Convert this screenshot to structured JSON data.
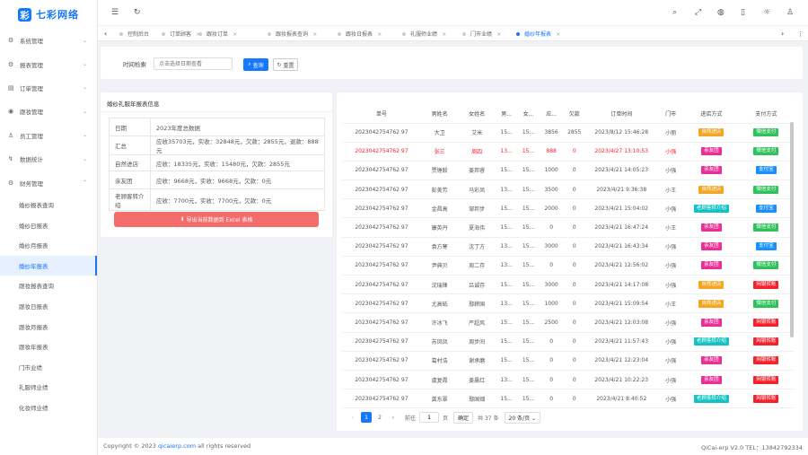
{
  "app": {
    "logo_mark": "彩",
    "title": "七彩网络"
  },
  "sidebar": {
    "menus": [
      {
        "label": "系统管理",
        "icon": "⚙"
      },
      {
        "label": "报表管理",
        "icon": "⚙"
      },
      {
        "label": "订单管理",
        "icon": "▤"
      },
      {
        "label": "跟妆管理",
        "icon": "◉"
      },
      {
        "label": "员工管理",
        "icon": "♙"
      },
      {
        "label": "数据统计",
        "icon": "↯"
      },
      {
        "label": "财务管理",
        "icon": "⚙"
      }
    ],
    "subitems": [
      "婚纱报表查询",
      "婚纱日报表",
      "婚纱月报表",
      "婚纱年报表",
      "跟妆报表查询",
      "跟妆日报表",
      "跟妆月报表",
      "跟妆年报表",
      "门市业绩",
      "礼服师业绩",
      "化妆师业绩"
    ],
    "active_index": 3
  },
  "header": {
    "icons": [
      "menu-fold-icon",
      "refresh-icon"
    ],
    "right_icons": [
      "search-icon",
      "expand-icon",
      "globe-icon",
      "mobile-icon",
      "theme-icon",
      "user-icon"
    ]
  },
  "tabs": [
    {
      "label": "控制后台",
      "closable": false
    },
    {
      "label": "订单顾客",
      "closable": true
    },
    {
      "label": "跟妆订单",
      "closable": true
    },
    {
      "label": "跟妆报表查询",
      "closable": true
    },
    {
      "label": "跟妆日报表",
      "closable": true
    },
    {
      "label": "礼服师业绩",
      "closable": true
    },
    {
      "label": "门市业绩",
      "closable": true
    },
    {
      "label": "婚纱年报表",
      "closable": true,
      "active": true
    }
  ],
  "search": {
    "label": "时间检索",
    "placeholder": "点击选择日期查看",
    "query_btn": "查询",
    "reset_btn": "重置"
  },
  "info": {
    "title": "婚纱礼服年报表信息",
    "rows": [
      {
        "k": "日期",
        "v": "2023年度总数据"
      },
      {
        "k": "汇总",
        "v": "应收35703元，实收：32848元，欠款：2855元，退款：888元"
      },
      {
        "k": "自然进店",
        "v": "应收：18335元，实收：15480元，欠款：2855元"
      },
      {
        "k": "亲友团",
        "v": "应收：9668元，实收：9668元，欠款：0元"
      },
      {
        "k": "老顾客转介绍",
        "v": "应收：7700元，实收：7700元，欠款：0元"
      }
    ],
    "export_btn": "导出当前数据到 Excel 表格"
  },
  "table": {
    "columns": [
      "单号",
      "男姓名",
      "女姓名",
      "男...",
      "女...",
      "应...",
      "欠款",
      "订单时间",
      "门市",
      "进店方式",
      "支付方式"
    ],
    "rows": [
      [
        "2023042754762 97",
        "大卫",
        "艾米",
        "15...",
        "15...",
        "3856",
        "2855",
        "2023/8/12 15:46:28",
        "小丽",
        "自然进店",
        "微信支付"
      ],
      [
        "2023042754762 97",
        "张三",
        "周四",
        "13...",
        "15...",
        "888",
        "0",
        "2023/4/27 13:10:53",
        "小强",
        "亲友团",
        "微信支付"
      ],
      [
        "2023042754762 97",
        "贾锤毅",
        "姜邦睿",
        "15...",
        "15...",
        "1000",
        "0",
        "2023/4/21 14:05:23",
        "小强",
        "亲友团",
        "支付宝"
      ],
      [
        "2023042754762 97",
        "彭美芳",
        "马彩凤",
        "13...",
        "15...",
        "3500",
        "0",
        "2023/4/21 9:36:38",
        "小王",
        "自然进店",
        "微信支付"
      ],
      [
        "2023042754762 97",
        "金昌高",
        "邹邦步",
        "15...",
        "15...",
        "2000",
        "0",
        "2023/4/21 15:04:02",
        "小强",
        "老顾客转介绍",
        "支付宝"
      ],
      [
        "2023042754762 97",
        "康英丹",
        "夏海伟",
        "15...",
        "15...",
        "0",
        "0",
        "2023/4/21 16:47:24",
        "小王",
        "亲友团",
        "微信支付"
      ],
      [
        "2023042754762 97",
        "袁方寒",
        "沈丁方",
        "13...",
        "15...",
        "3000",
        "0",
        "2023/4/21 16:43:34",
        "小强",
        "亲友团",
        "支付宝"
      ],
      [
        "2023042754762 97",
        "尹典贝",
        "周二存",
        "13...",
        "15...",
        "0",
        "0",
        "2023/4/21 12:56:02",
        "小强",
        "亲友团",
        "微信支付"
      ],
      [
        "2023042754762 97",
        "沈瑞锋",
        "吕诚存",
        "15...",
        "15...",
        "3000",
        "0",
        "2023/4/21 14:17:08",
        "小强",
        "自然进店",
        "网银转账"
      ],
      [
        "2023042754762 97",
        "尤高砥",
        "鄢耕国",
        "13...",
        "15...",
        "1000",
        "0",
        "2023/4/21 15:09:54",
        "小王",
        "自然进店",
        "微信支付"
      ],
      [
        "2023042754762 97",
        "许冰飞",
        "严超风",
        "15...",
        "15...",
        "2500",
        "0",
        "2023/4/21 12:03:08",
        "小强",
        "亲友团",
        "网银转账"
      ],
      [
        "2023042754762 97",
        "苏凤凤",
        "周步间",
        "15...",
        "15...",
        "0",
        "0",
        "2023/4/21 11:57:43",
        "小强",
        "老顾客转介绍",
        "网银转账"
      ],
      [
        "2023042754762 97",
        "葛村浩",
        "谢承磨",
        "15...",
        "15...",
        "0",
        "0",
        "2023/4/21 12:23:04",
        "小强",
        "亲友团",
        "网银转账"
      ],
      [
        "2023042754762 97",
        "虞复霞",
        "姜晨红",
        "13...",
        "15...",
        "0",
        "0",
        "2023/4/21 10:22:23",
        "小强",
        "亲友团",
        "网银转账"
      ],
      [
        "2023042754762 97",
        "龚东翠",
        "鄢国钿",
        "15...",
        "15...",
        "0",
        "0",
        "2023/4/21 8:40:52",
        "小强",
        "老顾客转介绍",
        "网银转账"
      ]
    ],
    "highlight_row": 1
  },
  "tag_colors": {
    "自然进店": "#f5a623",
    "亲友团": "#eb2f96",
    "老顾客转介绍": "#13c2c2",
    "微信支付": "#2fc25b",
    "支付宝": "#1890ff",
    "网银转账": "#f5222d"
  },
  "pager": {
    "prev": "‹",
    "pages": [
      "1",
      "2"
    ],
    "next": "›",
    "goto_prefix": "前往",
    "goto_value": "1",
    "goto_suffix": "页",
    "confirm": "确定",
    "total": "共 37 条",
    "size": "20 条/页"
  },
  "footer": {
    "copyright_prefix": "Copyright © 2023",
    "link": "qicaierp.com",
    "copyright_suffix": "all rights reserved",
    "version": "QiCai-erp V2.0 TEL：13842792334"
  }
}
